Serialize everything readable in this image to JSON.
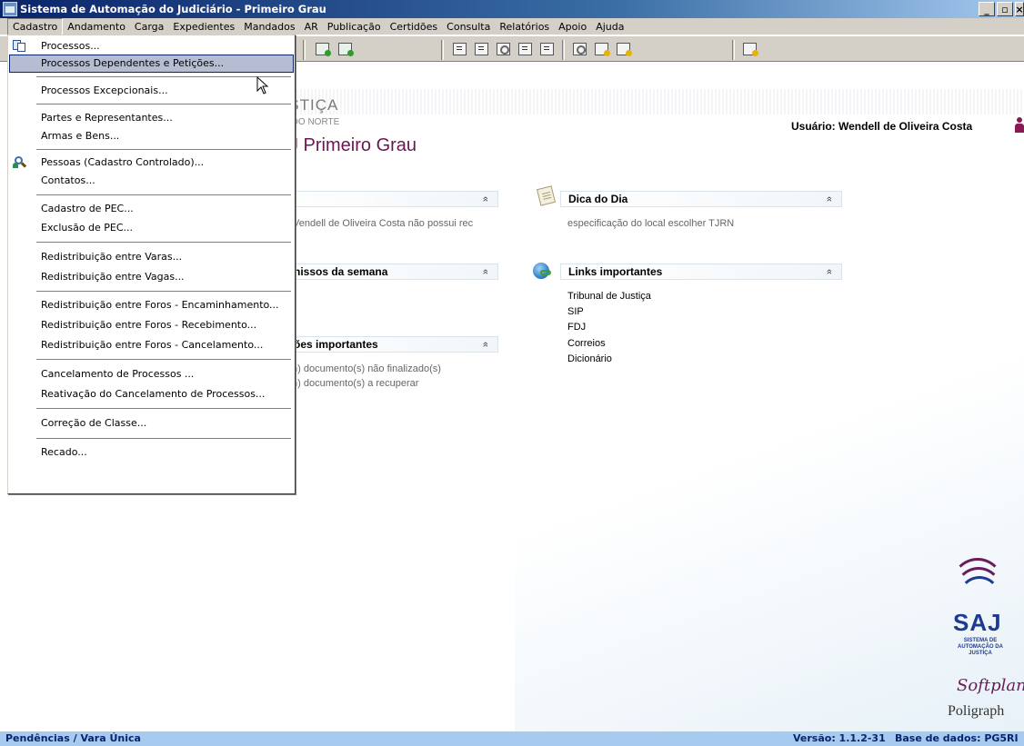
{
  "window": {
    "title": "Sistema de Automação do Judiciário - Primeiro Grau",
    "buttons": {
      "minimize": "_",
      "restore": "Ɇ",
      "close": "×"
    }
  },
  "menubar": [
    "Cadastro",
    "Andamento",
    "Carga",
    "Expedientes",
    "Mandados",
    "AR",
    "Publicação",
    "Certidões",
    "Consulta",
    "Relatórios",
    "Apoio",
    "Ajuda"
  ],
  "dropdown": {
    "items": [
      "Processos...",
      "Processos Dependentes e Petições...",
      "Processos Excepcionais...",
      "Partes e Representantes...",
      "Armas e Bens...",
      "Pessoas (Cadastro Controlado)...",
      "Contatos...",
      "Cadastro de PEC...",
      "Exclusão de PEC...",
      "Redistribuição entre Varas...",
      "Redistribuição entre Vagas...",
      "Redistribuição entre Foros - Encaminhamento...",
      "Redistribuição entre Foros - Recebimento...",
      "Redistribuição entre Foros - Cancelamento...",
      "Cancelamento de Processos ...",
      "Reativação do Cancelamento de Processos...",
      "Correção de Classe...",
      "Recado..."
    ],
    "highlighted": "Processos Dependentes e Petições..."
  },
  "header": {
    "org_title": "USTIÇA",
    "org_sub": "DE DO NORTE",
    "system_title": "J Primeiro Grau",
    "user_label": "Usuário: Wendell de Oliveira Costa"
  },
  "panels": {
    "left1": {
      "text": "Vendell de Oliveira Costa não possui rec"
    },
    "left2": {
      "title": "nissos da semana"
    },
    "left3": {
      "title": "ões importantes",
      "lines": [
        "m) documento(s) não finalizado(s)",
        "m) documento(s) a recuperar"
      ]
    },
    "dica": {
      "title": "Dica do Dia",
      "text": "especificação do local escolher TJRN"
    },
    "links": {
      "title": "Links importantes",
      "items": [
        "Tribunal de Justiça",
        "SIP",
        "FDJ",
        "Correios",
        "Dicionário"
      ]
    },
    "chevron": "»"
  },
  "logo": {
    "saj": "SAJ",
    "saj_sub": "SISTEMA DE AUTOMAÇÃO DA JUSTIÇA",
    "softplan": "Softplan",
    "poligraph": "Poligraph"
  },
  "statusbar": {
    "left": "Pendências / Vara Única",
    "version": "Versão: 1.1.2-31",
    "database": "Base de dados: PG5RI"
  },
  "colors": {
    "titlebar_start": "#0a246a",
    "menu_highlight": "#b6bdd2",
    "system_title": "#6c1650",
    "statusbar_bg": "#a6caf0"
  }
}
